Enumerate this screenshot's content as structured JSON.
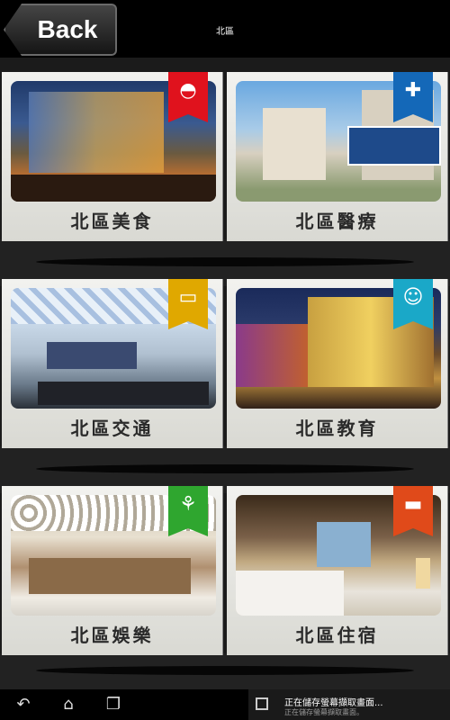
{
  "header": {
    "back_label": "Back",
    "title": "北區"
  },
  "cards": [
    {
      "label": "北區美食",
      "icon": "bun-icon",
      "glyph": "◓",
      "ribbon_color": "#e0121d",
      "photo": "restaurant-building-photo"
    },
    {
      "label": "北區醫療",
      "icon": "first-aid-kit-icon",
      "glyph": "✚",
      "ribbon_color": "#1468b8",
      "photo": "hospital-building-photo"
    },
    {
      "label": "北區交通",
      "icon": "bus-icon",
      "glyph": "▭",
      "ribbon_color": "#e0a800",
      "photo": "transit-station-photo"
    },
    {
      "label": "北區教育",
      "icon": "student-icon",
      "glyph": "☺",
      "ribbon_color": "#1aa8c8",
      "photo": "school-building-photo"
    },
    {
      "label": "北區娛樂",
      "icon": "balloons-icon",
      "glyph": "⚘",
      "ribbon_color": "#2fa62f",
      "photo": "mall-interior-photo"
    },
    {
      "label": "北區住宿",
      "icon": "bed-icon",
      "glyph": "▬",
      "ribbon_color": "#e04a1a",
      "photo": "hotel-room-photo"
    }
  ],
  "notification": {
    "title": "正在儲存螢幕擷取畫面...",
    "subtitle": "正在儲存螢幕擷取畫面。"
  }
}
